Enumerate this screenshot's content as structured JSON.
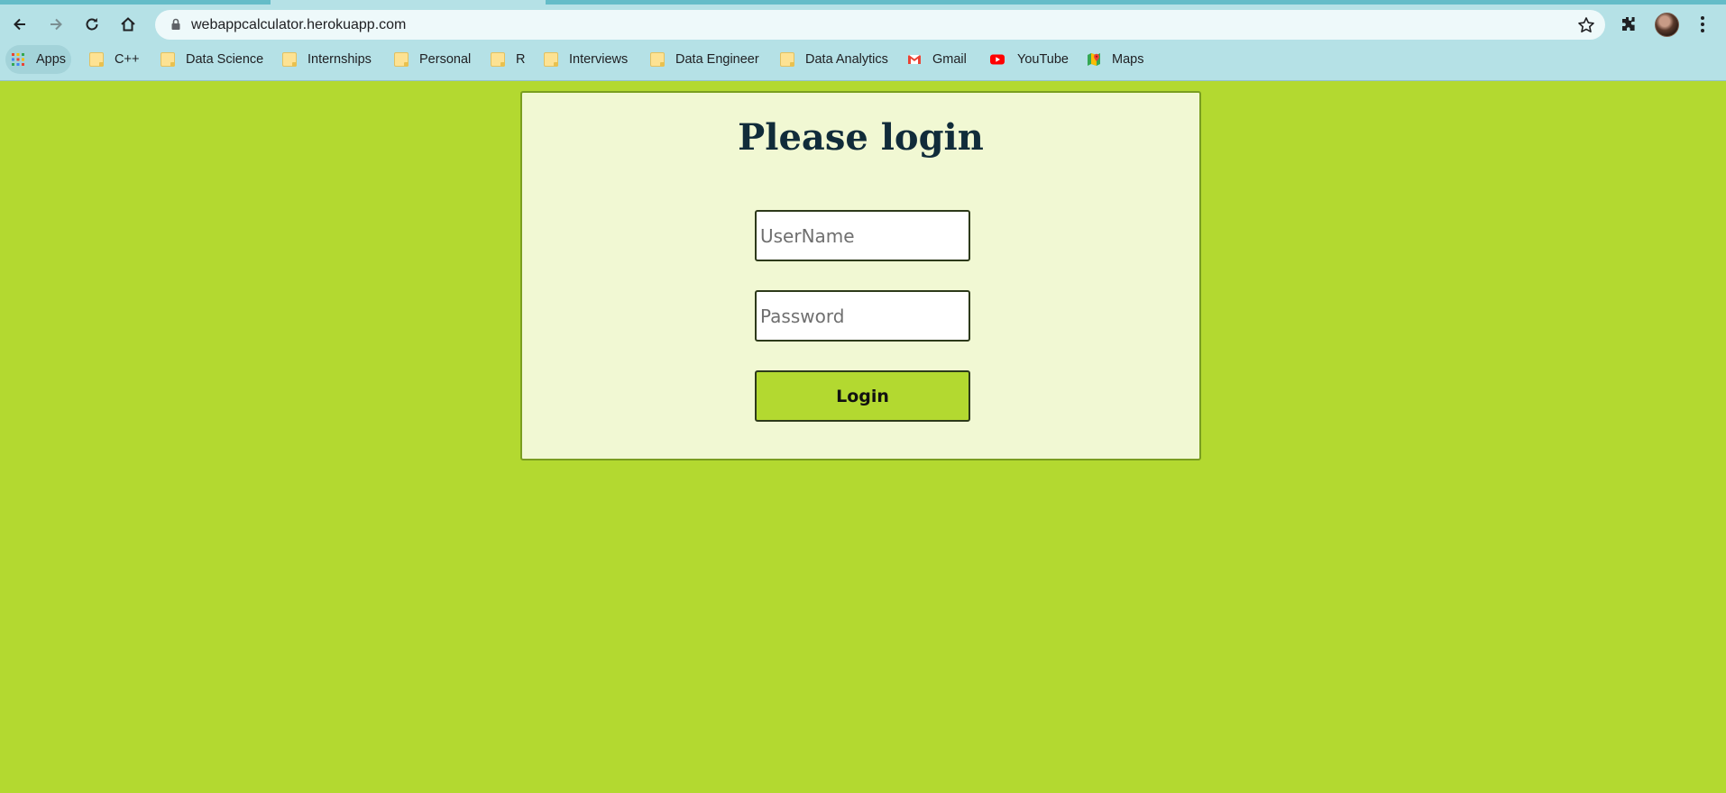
{
  "browser": {
    "url": "webappcalculator.herokuapp.com",
    "bookmarks": {
      "apps": "Apps",
      "items": [
        "C++",
        "Data Science",
        "Internships",
        "Personal",
        "R",
        "Interviews",
        "Data Engineer",
        "Data Analytics",
        "Gmail",
        "YouTube",
        "Maps"
      ]
    }
  },
  "login": {
    "title": "Please login",
    "username_placeholder": "UserName",
    "password_placeholder": "Password",
    "submit_label": "Login"
  },
  "colors": {
    "page_background": "#b3d930",
    "card_background": "#f1f8d3",
    "title_color": "#112c3a",
    "chrome_background": "#b5e1e6"
  }
}
